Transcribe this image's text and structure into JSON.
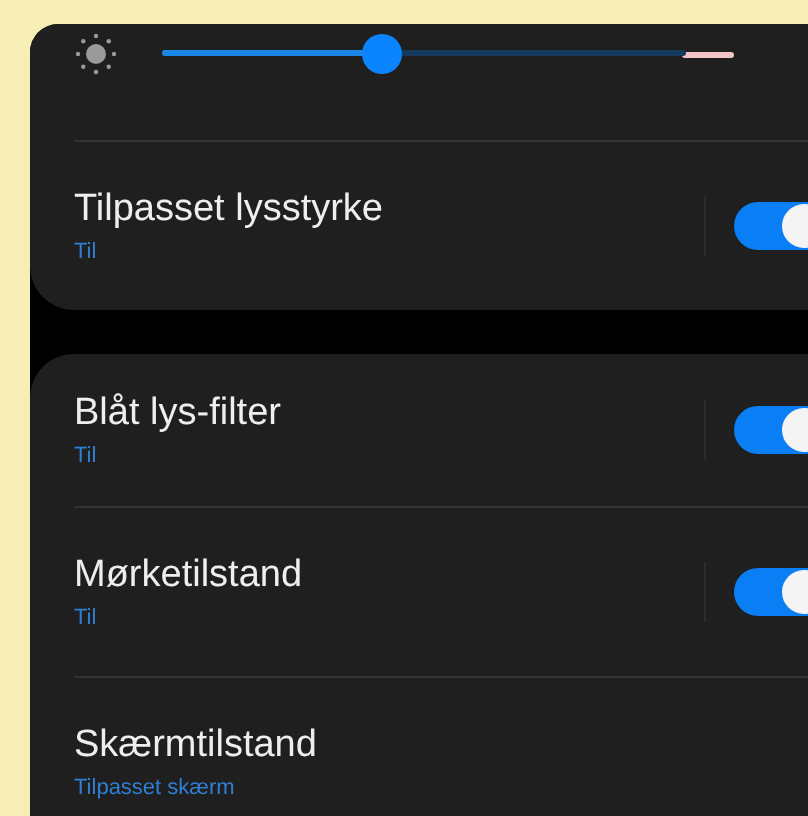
{
  "brightness": {
    "level": 0.42
  },
  "cards": [
    {
      "rows": [
        {
          "title": "Tilpasset lysstyrke",
          "subtitle": "Til",
          "kind": "toggle",
          "on": true
        }
      ]
    },
    {
      "rows": [
        {
          "title": "Blåt lys-filter",
          "subtitle": "Til",
          "kind": "toggle",
          "on": true
        },
        {
          "title": "Mørketilstand",
          "subtitle": "Til",
          "kind": "toggle",
          "on": true
        },
        {
          "title": "Skærmtilstand",
          "subtitle": "Tilpasset skærm",
          "kind": "plain"
        }
      ]
    }
  ]
}
